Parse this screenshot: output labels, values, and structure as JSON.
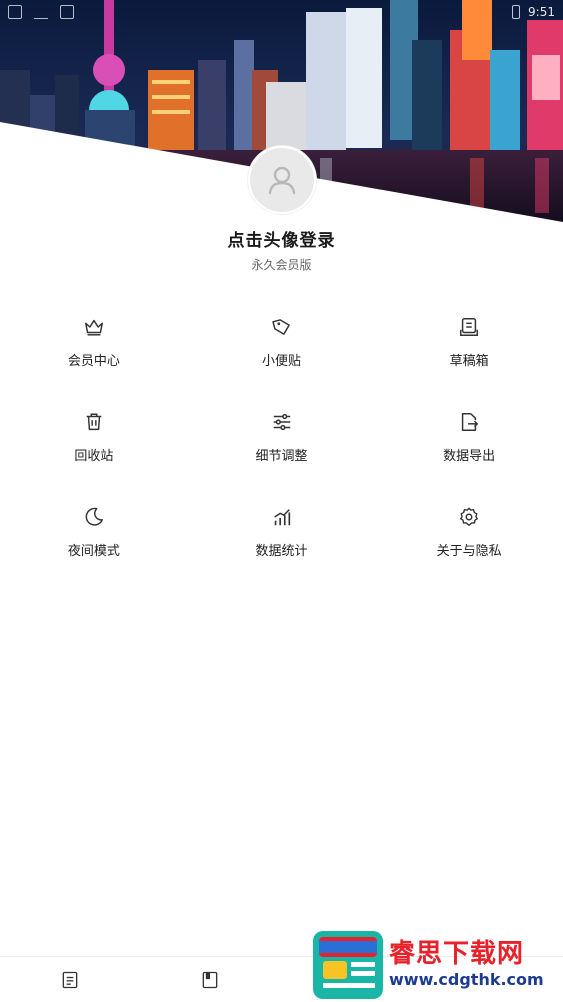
{
  "status_bar": {
    "time": "9:51"
  },
  "profile": {
    "title": "点击头像登录",
    "subtitle": "永久会员版"
  },
  "menu": [
    [
      {
        "label": "会员中心",
        "icon": "crown-icon"
      },
      {
        "label": "小便贴",
        "icon": "tag-icon"
      },
      {
        "label": "草稿箱",
        "icon": "draft-box-icon"
      }
    ],
    [
      {
        "label": "回收站",
        "icon": "trash-icon"
      },
      {
        "label": "细节调整",
        "icon": "sliders-icon"
      },
      {
        "label": "数据导出",
        "icon": "export-icon"
      }
    ],
    [
      {
        "label": "夜间模式",
        "icon": "moon-icon"
      },
      {
        "label": "数据统计",
        "icon": "chart-icon"
      },
      {
        "label": "关于与隐私",
        "icon": "gear-icon"
      }
    ]
  ],
  "bottom_nav": [
    {
      "icon": "document-icon"
    },
    {
      "icon": "notebook-icon"
    },
    {
      "icon": "profile-icon"
    }
  ],
  "watermark": {
    "title": "睿思下载网",
    "url": "www.cdgthk.com"
  },
  "colors": {
    "accent_red": "#e8222a",
    "accent_blue": "#1d3c8f",
    "icon_stroke": "#333333"
  }
}
